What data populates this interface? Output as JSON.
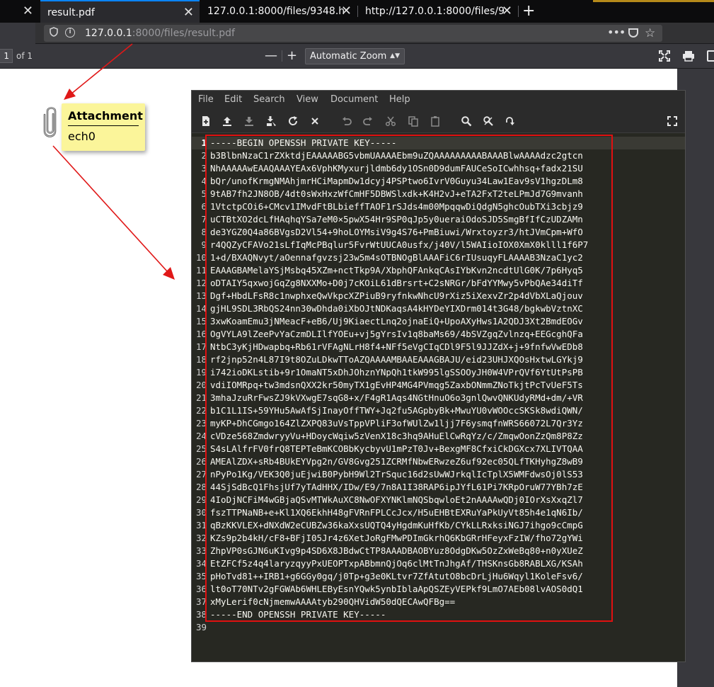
{
  "browser": {
    "tabs": [
      {
        "label": "",
        "close": "✕"
      },
      {
        "label": "result.pdf",
        "close": "✕"
      },
      {
        "label": "127.0.0.1:8000/files/9348.h",
        "close": "✕"
      },
      {
        "label": "http://127.0.0.1:8000/files/9",
        "close": "✕"
      }
    ],
    "new_tab": "+",
    "url_host": "127.0.0.1",
    "url_rest": ":8000/files/result.pdf",
    "url_dots": "•••"
  },
  "pdf_toolbar": {
    "page_number": "1",
    "page_count": "of 1",
    "zoom_out": "—",
    "zoom_in": "+",
    "zoom_value": "Automatic Zoom",
    "zoom_arrow": "▲▼"
  },
  "attachment": {
    "title": "Attachment",
    "filename": "ech0"
  },
  "editor": {
    "menu": [
      "File",
      "Edit",
      "Search",
      "View",
      "Document",
      "Help"
    ],
    "toolbar_icons": [
      "new-file-icon",
      "open-file-icon",
      "save-icon",
      "save-as-icon",
      "reload-icon",
      "close-icon",
      "undo-icon",
      "redo-icon",
      "cut-icon",
      "copy-icon",
      "paste-icon",
      "find-icon",
      "find-replace-icon",
      "goto-line-icon",
      "fullscreen-icon"
    ],
    "current_line": 1,
    "lines": [
      "-----BEGIN OPENSSH PRIVATE KEY-----",
      "b3BlbnNzaC1rZXktdjEAAAAABG5vbmUAAAAEbm9uZQAAAAAAAAABAAABlwAAAAdzc2gtcn",
      "NhAAAAAwEAAQAAAYEAx6VphKMyxurjldmb6dy1OSn0D9dumFAUCeSoICwhhsq+fadx21SU",
      "bQr/unofKrmgNMAhjmrHCiMapmDw1dcyj4PSPtwo6IvrV0Guyu34Law1Eav9sV1hgzDLm8",
      "9tAB7fh2JN8OB/4dt0sWxHxzWfCmHF5DBWSlxdk+K4H2vJ+eTA2FxT2teLPmJd7G9mvanh",
      "1VtctpCOi6+CMcv1IMvdFtBLbieffTAOF1rSJds4m00MpqqwDiQdgN5ghcOubTXi3cbjz9",
      "uCTBtXO2dcLfHAqhqYSa7eM0×5pwX54Hr9SP0qJp5y0ueraiOdoSJD5SmgBfIfCzUDZAMn",
      "de3YGZ0Q4a86BVgsD2Vl54+9hoLOYMsiV9g4S76+PmBiuwi/Wrxtoyzr3/htJVmCpm+WfO",
      "r4QQZyCFAVo21sLfIqMcPBqlur5FvrWtUUCA0usfx/j40V/l5WAIioIOX0XmX0klll1f6P7",
      "1+d/BXAQNvyt/aOennafgvzsj23w5m4sOTBNOgBlAAAFiC6rIUsuqyFLAAAAB3NzaC1yc2",
      "EAAAGBAMelaYSjMsbq45XZm+nctTkp9A/XbphQFAnkqCAsIYbKvn2ncdtUlG0K/7p6Hyq5",
      "oDTAIY5qxwojGqZg8NXXMo+D0j7cKOiL61dBrsrt+C2sNRGr/bFdYYMwy5vPbQAe34diTf",
      "Dgf+HbdLFsR8c1nwphxeQwVkpcXZPiuB9ryfnkwNhcU9rXiz5iXexvZr2p4dVbXLaQjouv",
      "gjHL9SDL3RbQS24nn30wDhda0iXbOJtNDKaqsA4kHYDeYIXDrm014t3G48/bgkwbVztnXC",
      "3xwKoamEmu3jNMeacF+eB6/Uj9KiaectLnq2ojnaEiQ+UpoAXyHws1A2QDJ3Xt2BmdEOGv",
      "OgVYLA9lZeePvYaCzmDLIlfYOEu+vj5gYrsIv1q8baMs69/4bSVZgqZvlnzq+EEGcghQFa",
      "NtbC3yKjHDwapbq+Rb61rVFAgNLrH8f4+NFf5eVgCIqCDl9F5l9JJZdX+j+9fnfwVwEDb8",
      "rf2jnp52n4L87I9t8OZuLDkwTToAZQAAAAMBAAEAAAGBAJU/eid23UHJXQOsHxtwLGYkj9",
      "i742ioDKLstib+9r1OmaNT5xDhJOhznYNpQh1tkW995lgSSOOyJH0W4VPrQVf6YtUtPsPB",
      "vdiIOMRpq+tw3mdsnQXX2kr50myTX1gEvHP4MG4PVmqg5ZaxbONmmZNoTkjtPcTvUeF5Ts",
      "3mhaJzuRrFwsZJ9kVXwgE7sqG8+x/F4gR1Aqs4NGtHnuO6o3gnlQwvQNKUdyRMd+dm/+VR",
      "b1C1L1IS+59YHu5AwAfSjInayOffTWY+Jq2fu5AGpbyBk+MwuYU0vWOOccSKSk8wdiQWN/",
      "myKP+DhCGmgo164ZlZXPQ83uVsTppVPliF3ofWUlZw1ljj7F6ysmqfnWRS66072L7Qr3Yz",
      "cVDze568ZmdwryyVu+HDoycWqiw5zVenX18c3hq9AHuElCwRqYz/c/ZmqwOonZzQm8P8Zz",
      "S4sLAlfrFV0frQ8TEPTeBmKCOBbKycbyvU1mPzT0Jv+BexgMF8CfxiCkDGXcx7XLIVTQAA",
      "AMEAlZDX+sRb4BUkEYVpg2n/GV8Gvg251ZCRMfNbwERwzeZ6uf92ec05QLfTKHyhgZ8wB9",
      "nPyPo1Kg/VEK3Q0juEjwiB0PybH9Wl2TrSquc16d2sUwWJrkqlIcTplX5WMFdwsOj0lS53",
      "44SjSdBcQ1FhsjUf7yTAdHHX/IDw/E9/7n8A1I38RAP6ipJYfL61Pi7KRpOruW77YBh7zE",
      "4IoDjNCFiM4wGBjaQSvMTWkAuXC8NwOFXYNKlmNQSbqwloEt2nAAAAwQDj0IOrXsXxqZl7",
      "fszTTPNaNB+e+Kl1XQ6EkhH48gFVRnFPLCcJcx/H5uEHBtEXRuYaPkUyVt85h4e1qN6Ib/",
      "qBzKKVLEX+dNXdW2eCUBZw36kaXxsUQTQ4yHgdmKuHfKb/CYkLLRxksiNGJ7ihgo9cCmpG",
      "KZs9p2b4kH/cF8+BFjI05Jr4z6XetJoRgFMwPDImGkrhQ6KbGRrHFeyxFzIW/fho72gYWi",
      "ZhpVP0sGJN6uKIvg9p4SD6X8JBdwCtTP8AAADBAOBYuz8OdgDKw5OzZxWeBq80+n0yXUeZ",
      "EtZFCf5z4q4laryzqyyPxUEOPTxpABbmnQjOq6clMtTnJhgAf/THSKnsGb8RABLXG/KSAh",
      "pHoTvd81++IRB1+g6GGy0gq/j0Tp+g3e0KLtvr7ZfAtutO8bcDrLjHu6Wqyl1KoleFsv6/",
      "lt0oT70NTv2gFGWAb6WHLEByEsnYQwk5ynbIblaApQSZEyVEPkf9LmO7AEb08lvAOS0dQ1",
      "xMyLerif0cNjmemwAAAAtyb290QHVidW50dQECAwQFBg==",
      "-----END OPENSSH PRIVATE KEY-----",
      ""
    ]
  },
  "colors": {
    "selection_box": "#e01010",
    "arrow": "#e01818",
    "note_background": "#fbf59a",
    "editor_background": "#272822"
  }
}
